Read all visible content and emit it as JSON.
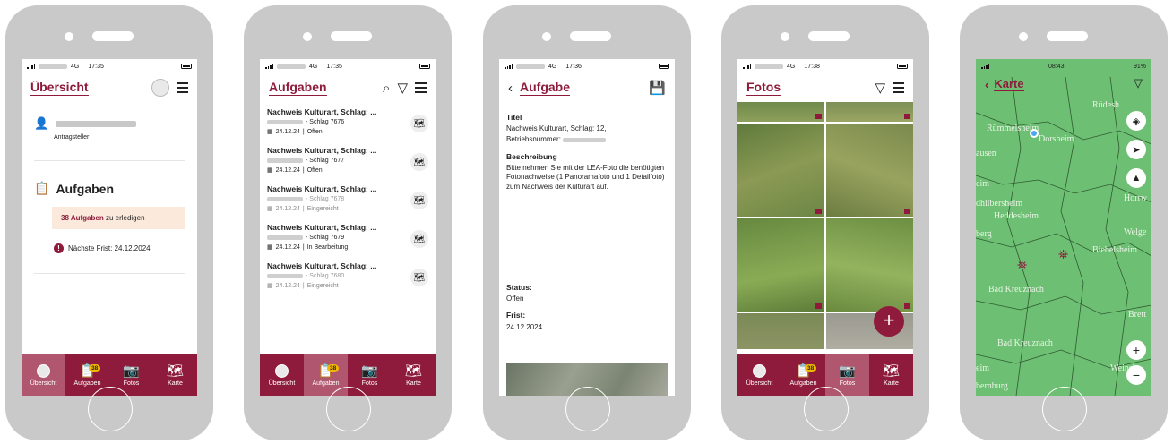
{
  "colors": {
    "primary": "#8e1b3b",
    "map_green": "#6dbf73"
  },
  "status": {
    "carrier": "4G",
    "time1": "17:35",
    "time2": "17:35",
    "time3": "17:36",
    "time4": "17:38",
    "time5": "08:43",
    "battery5": "91%"
  },
  "tabs": {
    "overview": "Übersicht",
    "tasks": "Aufgaben",
    "photos": "Fotos",
    "map": "Karte",
    "badge": "38"
  },
  "screen1": {
    "title": "Übersicht",
    "role": "Antragsteller",
    "tasks_heading": "Aufgaben",
    "tasks_count": "38 Aufgaben",
    "tasks_suffix": " zu erledigen",
    "deadline": "Nächste Frist: 24.12.2024"
  },
  "screen2": {
    "title": "Aufgaben",
    "items": [
      {
        "title": "Nachweis Kulturart, Schlag: ...",
        "schlag": "- Schlag 7676",
        "date": "24.12.24",
        "status": "Offen",
        "dim": false
      },
      {
        "title": "Nachweis Kulturart, Schlag: ...",
        "schlag": "- Schlag 7677",
        "date": "24.12.24",
        "status": "Offen",
        "dim": false
      },
      {
        "title": "Nachweis Kulturart, Schlag: ...",
        "schlag": "- Schlag 7678",
        "date": "24.12.24",
        "status": "Eingereicht",
        "dim": true
      },
      {
        "title": "Nachweis Kulturart, Schlag: ...",
        "schlag": "- Schlag 7679",
        "date": "24.12.24",
        "status": "In Bearbeitung",
        "dim": false
      },
      {
        "title": "Nachweis Kulturart, Schlag: ...",
        "schlag": "- Schlag 7680",
        "date": "24.12.24",
        "status": "Eingereicht",
        "dim": true
      }
    ]
  },
  "screen3": {
    "title": "Aufgabe",
    "title_label": "Titel",
    "title_value": "Nachweis Kulturart, Schlag: 12,",
    "betrieb_label": "Betriebsnummer:",
    "desc_label": "Beschreibung",
    "desc_value": "Bitte nehmen Sie mit der LEA-Foto die benötigten Fotonachweise (1 Panoramafoto und 1 Detailfoto) zum Nachweis der Kulturart auf.",
    "status_label": "Status:",
    "status_value": "Offen",
    "deadline_label": "Frist:",
    "deadline_value": "24.12.2024"
  },
  "screen4": {
    "title": "Fotos",
    "fab": "+"
  },
  "screen5": {
    "title": "Karte",
    "towns": [
      "Rümmelsheim",
      "Dorsheim",
      "Rüdesh",
      "ausen",
      "eim",
      "dhilbersheim",
      "Heddesheim",
      "berg",
      "Horrw",
      "Welge",
      "Biebelsheim",
      "Bad Kreuznach",
      "Bad Kreuznach",
      "eim",
      "bernburg",
      "Weinsh",
      "Brett"
    ],
    "zoom_in": "+",
    "zoom_out": "−"
  }
}
